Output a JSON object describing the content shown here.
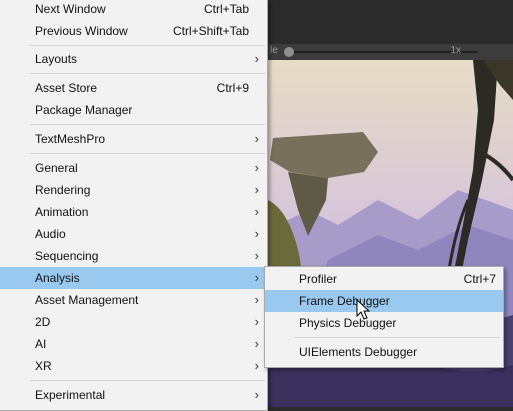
{
  "game_toolbar": {
    "scale_label": "le",
    "scale_value": "1x"
  },
  "window_menu": {
    "items": [
      {
        "label": "Next Window",
        "shortcut": "Ctrl+Tab"
      },
      {
        "label": "Previous Window",
        "shortcut": "Ctrl+Shift+Tab"
      },
      {
        "label": "Layouts"
      },
      {
        "label": "Asset Store",
        "shortcut": "Ctrl+9"
      },
      {
        "label": "Package Manager"
      },
      {
        "label": "TextMeshPro"
      },
      {
        "label": "General"
      },
      {
        "label": "Rendering"
      },
      {
        "label": "Animation"
      },
      {
        "label": "Audio"
      },
      {
        "label": "Sequencing"
      },
      {
        "label": "Analysis"
      },
      {
        "label": "Asset Management"
      },
      {
        "label": "2D"
      },
      {
        "label": "AI"
      },
      {
        "label": "XR"
      },
      {
        "label": "Experimental"
      }
    ],
    "arrow": "›"
  },
  "analysis_submenu": {
    "items": [
      {
        "label": "Profiler",
        "shortcut": "Ctrl+7"
      },
      {
        "label": "Frame Debugger"
      },
      {
        "label": "Physics Debugger"
      },
      {
        "label": "UIElements Debugger"
      }
    ]
  },
  "colors": {
    "menu_bg": "#f2f2f2",
    "highlight": "#99c9ef",
    "separator": "#d3d3d3"
  }
}
